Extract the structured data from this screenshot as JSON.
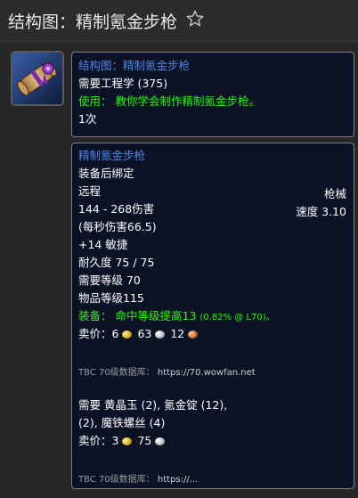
{
  "header": {
    "title": "结构图：精制氪金步枪"
  },
  "icons": {
    "item": "scroll-schematic-icon",
    "favorite": "star-outline-icon"
  },
  "tooltip_recipe": {
    "name": "结构图：精制氪金步枪",
    "requirement": "需要工程学 (375)",
    "use_prefix": "使用：",
    "use_text": "教你学会制作精制氪金步枪。",
    "charges": "1次"
  },
  "tooltip_item": {
    "name": "精制氪金步枪",
    "bind": "装备后绑定",
    "slot": "远程",
    "type": "枪械",
    "damage": "144 - 268伤害",
    "speed": "速度 3.10",
    "dps": "(每秒伤害66.5)",
    "stat": "+14 敏捷",
    "durability": "耐久度 75 / 75",
    "req_level": "需要等级 70",
    "item_level": "物品等级115",
    "equip_prefix": "装备：",
    "equip_text": "命中等级提高13",
    "equip_note": "(0.82% @ L70)。",
    "sell_label": "卖价：",
    "sell_gold": "6",
    "sell_silver": "63",
    "sell_copper": "12",
    "db_label": "TBC 70级数据库：",
    "db_url": "https://70.wowfan.net",
    "reagents_line1": "需要 黄晶玉 (2), 氪金锭 (12),",
    "reagents_line2": "(2), 魔铁螺丝 (4)",
    "sell2_label": "卖价：",
    "sell2_gold": "3",
    "sell2_silver": "75",
    "db2_label": "TBC 70级数据库：",
    "db2_url": "https://..."
  },
  "colors": {
    "item_name_blue": "#4a86e8",
    "use_green": "#1eff00",
    "tooltip_bg": "#0b1226",
    "page_bg": "#272727"
  }
}
